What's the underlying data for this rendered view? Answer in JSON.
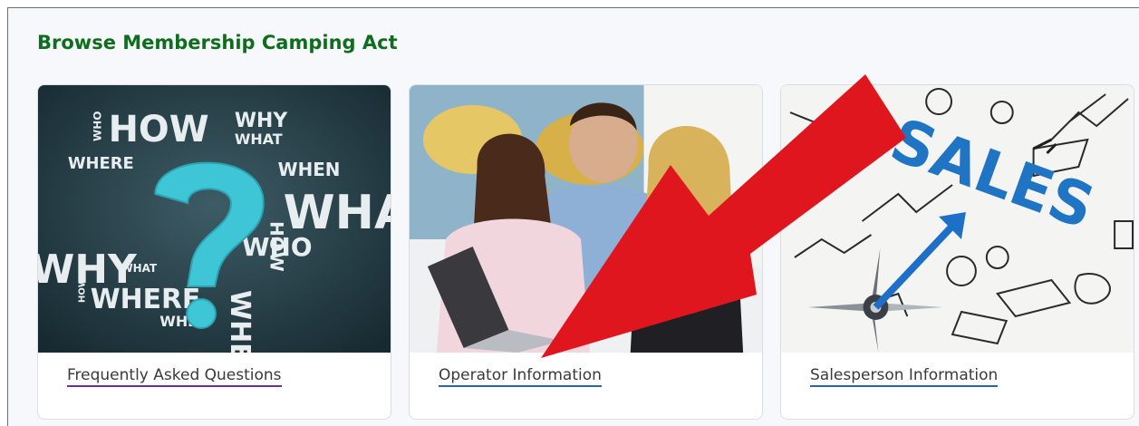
{
  "section": {
    "title": "Browse Membership Camping Act"
  },
  "cards": [
    {
      "link_label": "Frequently Asked Questions",
      "image_words": [
        "WHO",
        "HOW",
        "WHY",
        "WHAT",
        "WHERE",
        "WHEN",
        "HOW",
        "WHA",
        "WHO",
        "WHY",
        "WHAT",
        "HOW",
        "WHERE",
        "WHEN"
      ],
      "image_icon": "question-mark-icon"
    },
    {
      "link_label": "Operator Information",
      "image_icon": "people-with-laptop-photo"
    },
    {
      "link_label": "Salesperson Information",
      "image_words": [
        "SALES"
      ],
      "image_icon": "sales-compass-sketch"
    }
  ],
  "annotation": {
    "icon": "red-arrow-icon",
    "color": "#e0161f"
  },
  "colors": {
    "title": "#0e6e1d",
    "link_underline": "#2d62b0",
    "faq_underline": "#6a2f9e"
  }
}
